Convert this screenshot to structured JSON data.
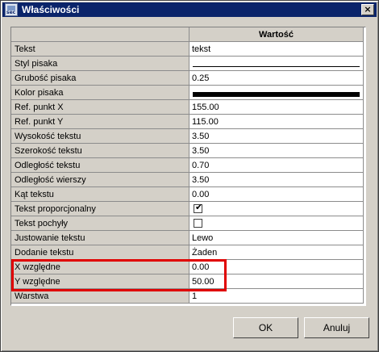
{
  "window": {
    "title": "Właściwości",
    "icon": "app-icon",
    "icon_label": "sec",
    "close": "×"
  },
  "table": {
    "header": {
      "value": "Wartość"
    },
    "rows": [
      {
        "name": "Tekst",
        "value": "tekst",
        "type": "text"
      },
      {
        "name": "Styl pisaka",
        "value": "",
        "type": "line-thin"
      },
      {
        "name": "Grubość pisaka",
        "value": "0.25",
        "type": "text"
      },
      {
        "name": "Kolor pisaka",
        "value": "",
        "type": "line-thick",
        "color": "#000000"
      },
      {
        "name": "Ref. punkt X",
        "value": "155.00",
        "type": "text"
      },
      {
        "name": "Ref. punkt Y",
        "value": "115.00",
        "type": "text"
      },
      {
        "name": "Wysokość tekstu",
        "value": "3.50",
        "type": "text"
      },
      {
        "name": "Szerokość tekstu",
        "value": "3.50",
        "type": "text"
      },
      {
        "name": "Odległość tekstu",
        "value": "0.70",
        "type": "text"
      },
      {
        "name": "Odległość wierszy",
        "value": "3.50",
        "type": "text"
      },
      {
        "name": "Kąt tekstu",
        "value": "0.00",
        "type": "text"
      },
      {
        "name": "Tekst proporcjonalny",
        "value": "",
        "type": "checkbox",
        "checked": true
      },
      {
        "name": "Tekst pochyły",
        "value": "",
        "type": "checkbox",
        "checked": false
      },
      {
        "name": "Justowanie tekstu",
        "value": "Lewo",
        "type": "text"
      },
      {
        "name": "Dodanie tekstu",
        "value": "Żaden",
        "type": "text"
      },
      {
        "name": "X względne",
        "value": "0.00",
        "type": "text"
      },
      {
        "name": "Y względne",
        "value": "50.00",
        "type": "text"
      },
      {
        "name": "Warstwa",
        "value": "1",
        "type": "text"
      }
    ]
  },
  "highlight": {
    "color": "#e00000"
  },
  "buttons": {
    "ok": "OK",
    "cancel": "Anuluj"
  }
}
